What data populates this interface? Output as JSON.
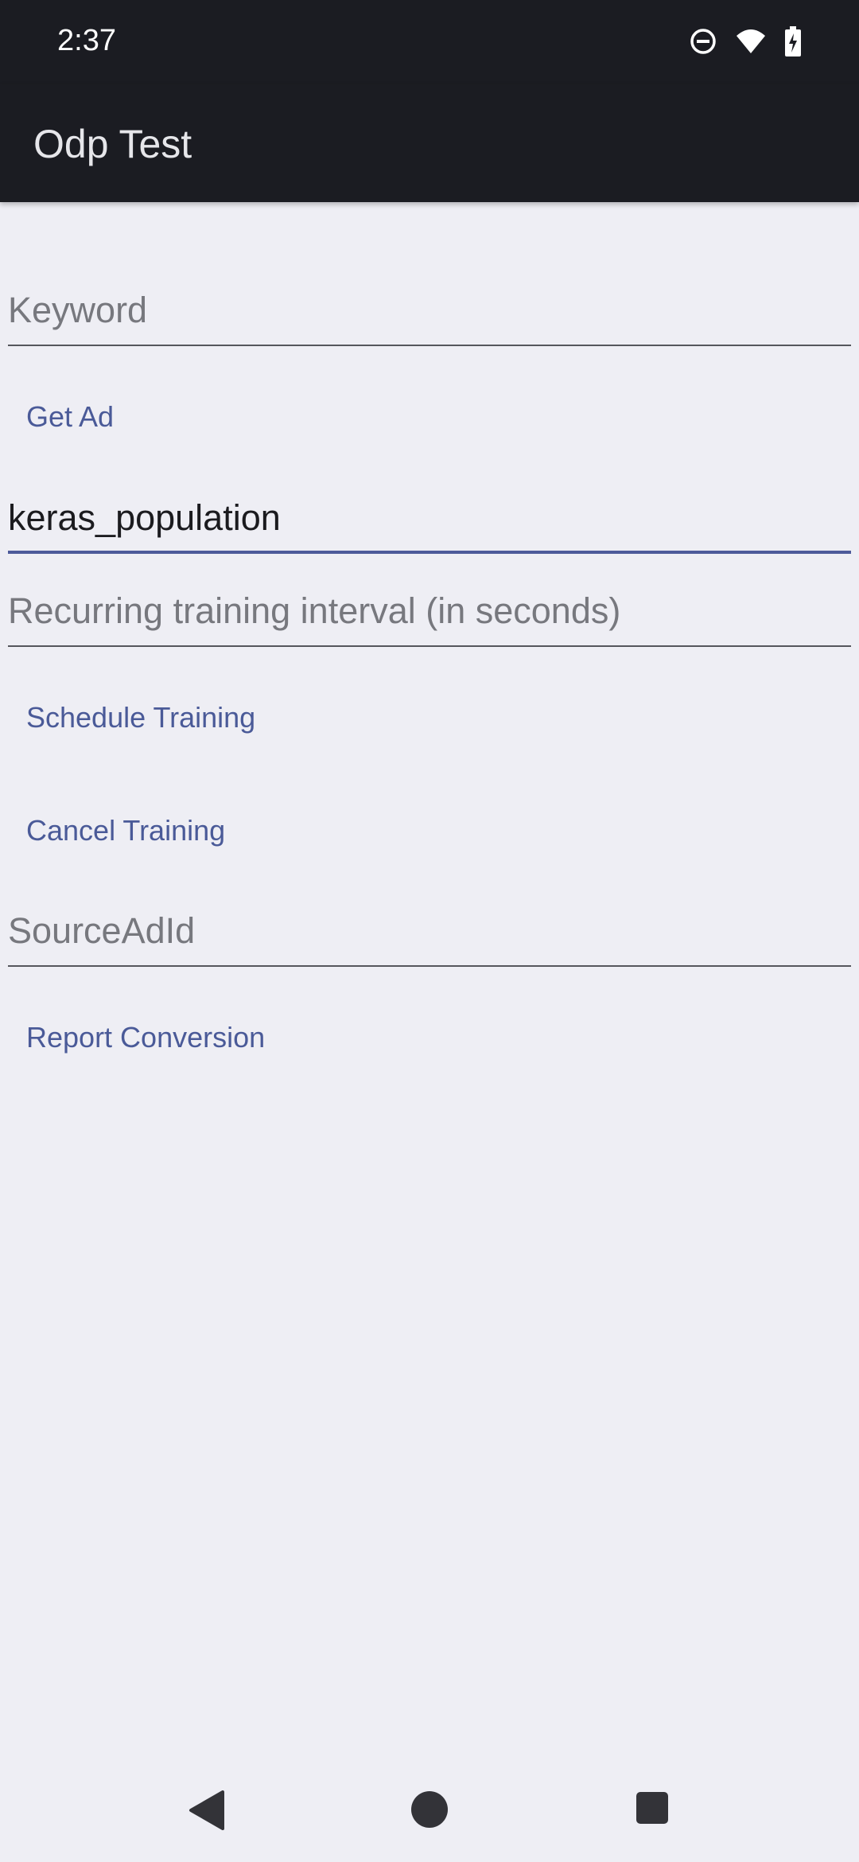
{
  "status_bar": {
    "time": "2:37",
    "icons": [
      "do-not-disturb-icon",
      "wifi-icon",
      "battery-charging-icon"
    ]
  },
  "app_bar": {
    "title": "Odp Test"
  },
  "form": {
    "keyword_placeholder": "Keyword",
    "get_ad_label": "Get Ad",
    "population_value": "keras_population",
    "interval_placeholder": "Recurring training interval (in seconds)",
    "schedule_training_label": "Schedule Training",
    "cancel_training_label": "Cancel Training",
    "source_ad_id_placeholder": "SourceAdId",
    "report_conversion_label": "Report Conversion"
  },
  "nav_bar": {
    "icons": [
      "back-icon",
      "home-icon",
      "recents-icon"
    ]
  },
  "colors": {
    "app_bar_bg": "#1b1c22",
    "background": "#eeeef4",
    "accent": "#4a5a98"
  }
}
